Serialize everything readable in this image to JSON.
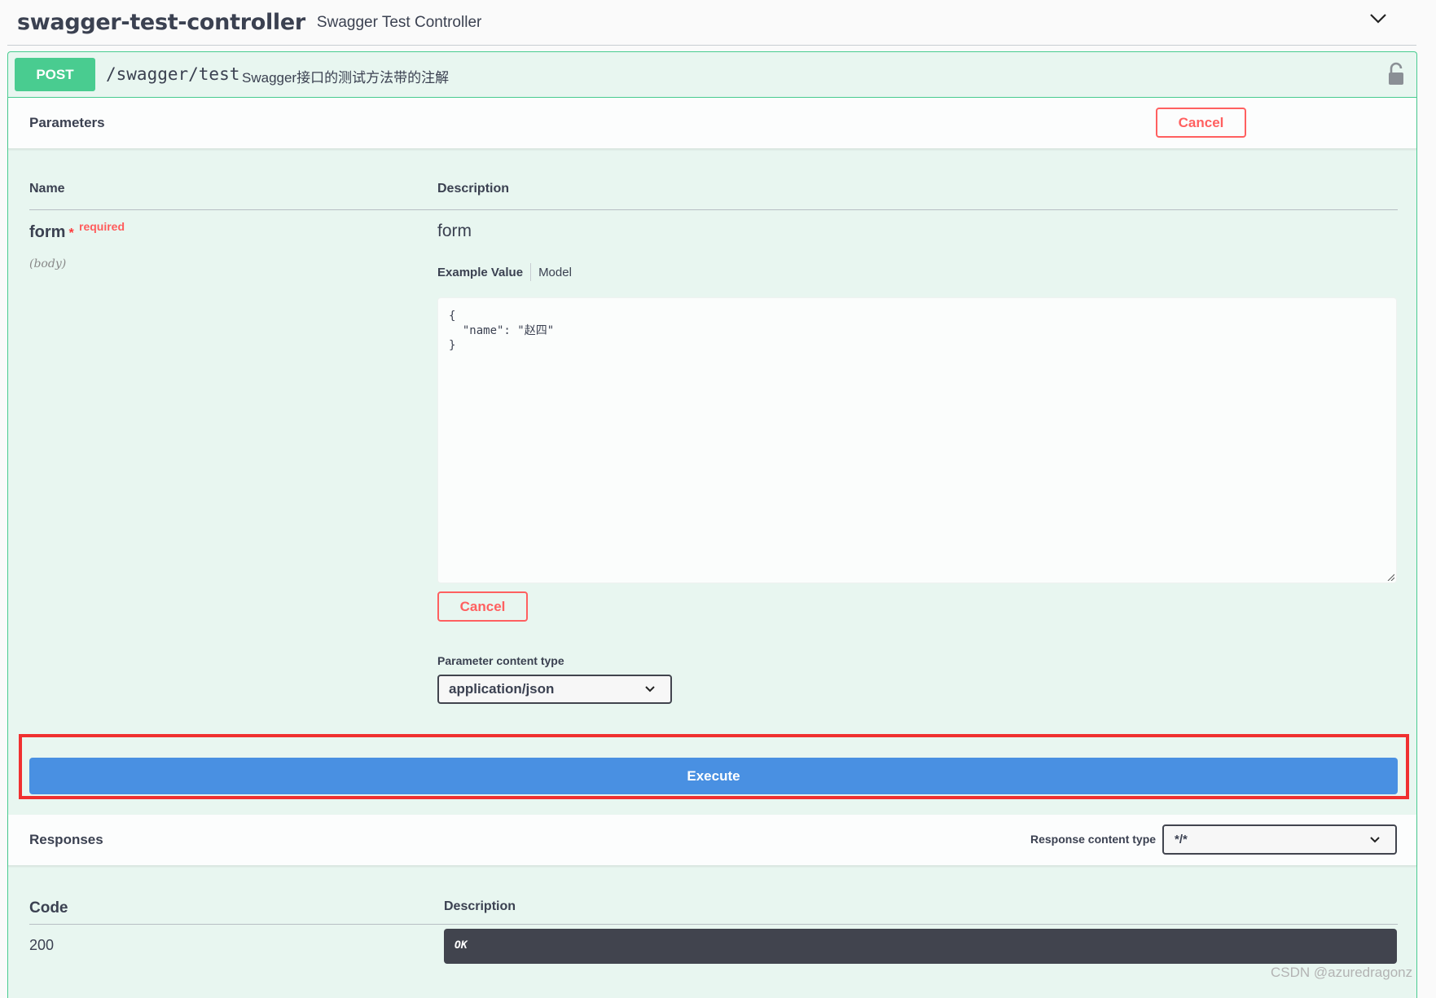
{
  "tag": {
    "title": "swagger-test-controller",
    "description": "Swagger Test Controller"
  },
  "operation": {
    "method": "POST",
    "path": "/swagger/test",
    "summary": "Swagger接口的测试方法带的注解",
    "method_color": "#49cc90"
  },
  "parameters": {
    "label": "Parameters",
    "cancel_label": "Cancel",
    "col_name": "Name",
    "col_description": "Description",
    "items": [
      {
        "name": "form",
        "required_marker": "*",
        "required_label": "required",
        "in": "(body)",
        "description": "form",
        "tab_example": "Example Value",
        "tab_model": "Model",
        "body_value": "{\n  \"name\": \"赵四\"\n}",
        "cancel_label": "Cancel",
        "content_type_label": "Parameter content type",
        "content_type_value": "application/json"
      }
    ]
  },
  "execute": {
    "label": "Execute",
    "color": "#4990e2"
  },
  "responses": {
    "label": "Responses",
    "content_type_label": "Response content type",
    "content_type_value": "*/*",
    "col_code": "Code",
    "col_description": "Description",
    "rows": [
      {
        "code": "200",
        "description": "OK"
      }
    ]
  },
  "watermark": "CSDN @azuredragonz",
  "colors": {
    "cancel": "#ff6060",
    "highlight": "#f03030",
    "text": "#3b4151"
  }
}
